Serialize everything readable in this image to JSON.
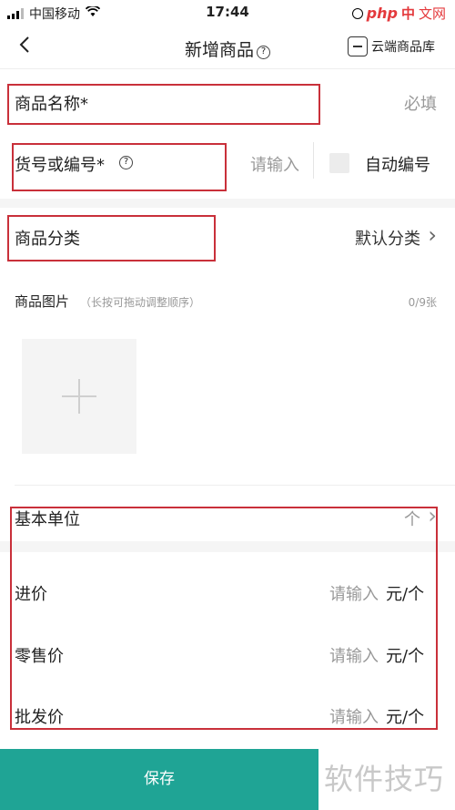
{
  "status_bar": {
    "carrier": "中国移动",
    "time": "17:44",
    "watermark_php": "php",
    "watermark_cn": "中",
    "watermark_wen": "文网"
  },
  "nav": {
    "back_glyph": "‹",
    "title": "新增商品",
    "help_glyph": "?",
    "cloud_label": "云端商品库"
  },
  "fields": {
    "name": {
      "label": "商品名称*",
      "placeholder": "必填"
    },
    "sku": {
      "label": "货号或编号*",
      "placeholder": "请输入",
      "auto_label": "自动编号"
    },
    "category": {
      "label": "商品分类",
      "value": "默认分类",
      "chevron": "›"
    },
    "images": {
      "label": "商品图片",
      "hint": "（长按可拖动调整顺序）",
      "count": "0/9张"
    },
    "unit": {
      "label": "基本单位",
      "value": "个",
      "chevron": "›"
    },
    "cost": {
      "label": "进价",
      "placeholder": "请输入",
      "suffix": "元/个"
    },
    "retail": {
      "label": "零售价",
      "placeholder": "请输入",
      "suffix": "元/个"
    },
    "wholesale": {
      "label": "批发价",
      "placeholder": "请输入",
      "suffix": "元/个"
    }
  },
  "save_label": "保存",
  "watermark_text": "软件技巧",
  "colors": {
    "accent": "#1fa495",
    "highlight_box": "#c9303a"
  }
}
